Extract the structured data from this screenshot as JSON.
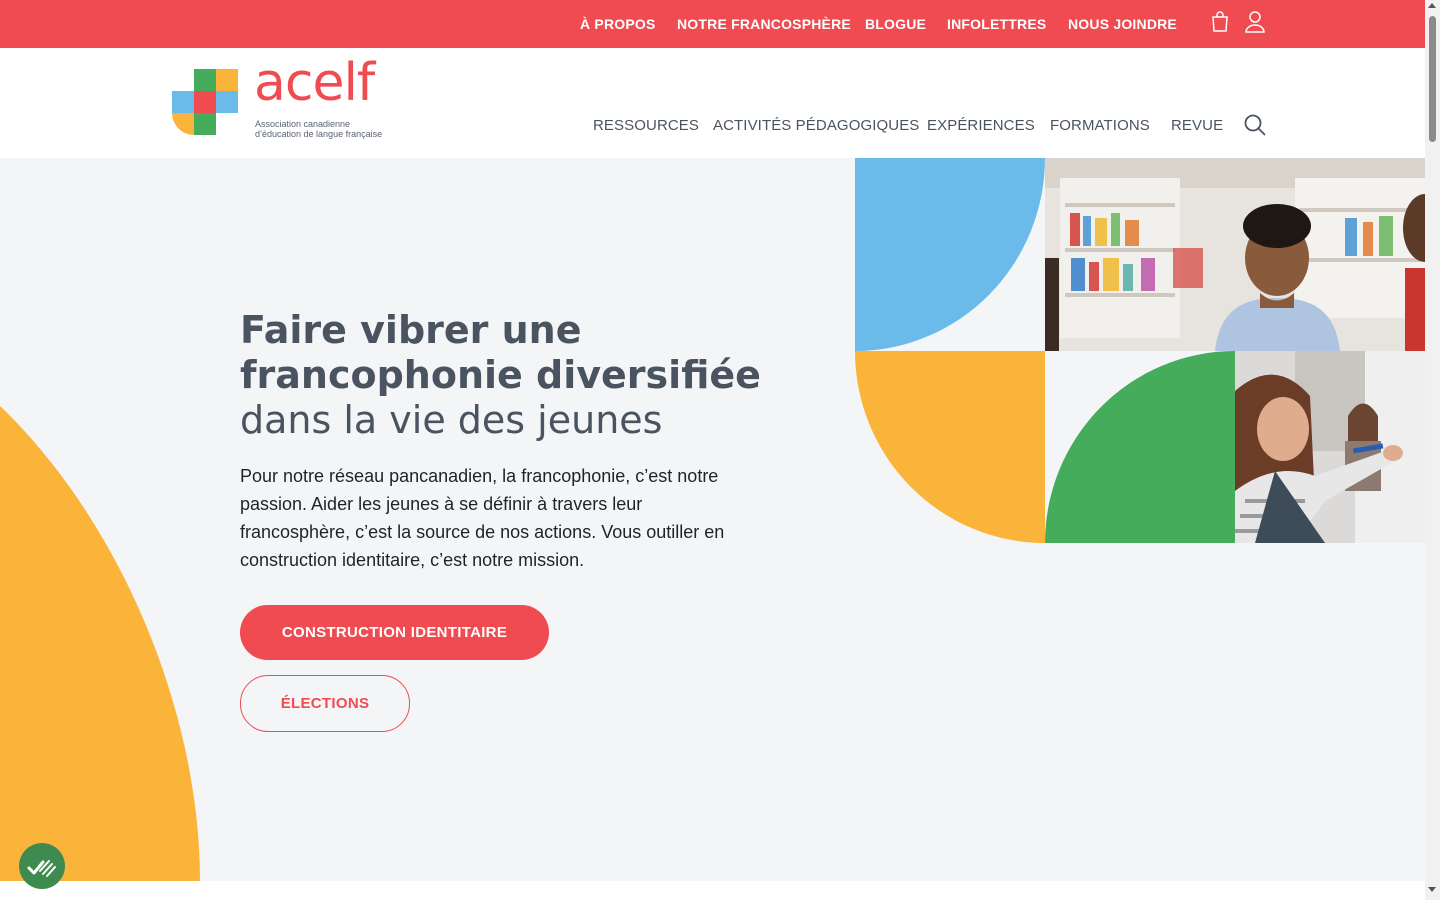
{
  "topbar": {
    "links": [
      "À PROPOS",
      "NOTRE FRANCOSPHÈRE",
      "BLOGUE",
      "INFOLETTRES",
      "NOUS JOINDRE"
    ],
    "icons": [
      "shopping-bag-icon",
      "user-icon"
    ],
    "background": "#ef4b50"
  },
  "logo": {
    "wordmark": "acelf",
    "subtitle_line1": "Association canadienne",
    "subtitle_line2": "d’éducation de langue française"
  },
  "mainnav": {
    "links": [
      "RESSOURCES",
      "ACTIVITÉS PÉDAGOGIQUES",
      "EXPÉRIENCES",
      "FORMATIONS",
      "REVUE"
    ],
    "search_icon": "search-icon"
  },
  "hero": {
    "title_line1": "Faire vibrer une",
    "title_line2": "francophonie diversifiée",
    "title_line3": "dans la vie des jeunes",
    "body": "Pour notre réseau pancanadien, la francophonie, c’est notre passion. Aider les jeunes à se définir à travers leur francosphère, c’est la source de nos actions. Vous outiller en construction identitaire, c’est notre mission.",
    "primary_button": "CONSTRUCTION IDENTITAIRE",
    "secondary_button": "ÉLECTIONS"
  },
  "colors": {
    "brand_red": "#ef4b50",
    "yellow": "#fbb43a",
    "blue": "#6bbbea",
    "green": "#45ac5b",
    "text_dark": "#4a5460",
    "hero_bg": "#f4f5f7"
  },
  "badge": {
    "icon": "check-marks-icon"
  }
}
